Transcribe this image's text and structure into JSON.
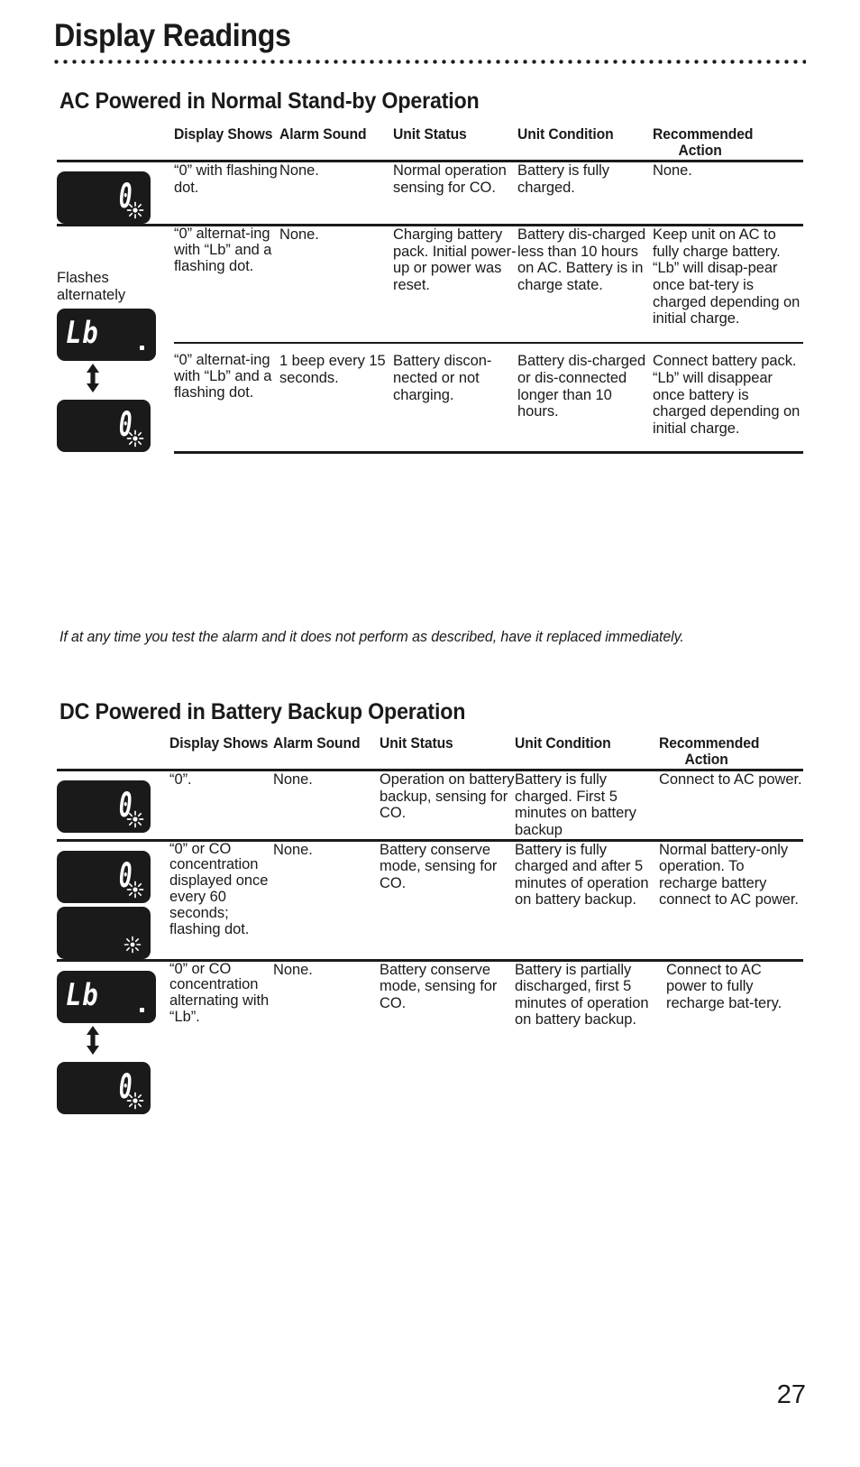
{
  "page": {
    "title": "Display Readings",
    "number": "27"
  },
  "note": {
    "text": "If at any time you test the alarm and it does not perform as described, have it replaced immediately."
  },
  "columns": {
    "display_shows": "Display Shows",
    "alarm_sound": "Alarm Sound",
    "unit_status": "Unit Status",
    "unit_condition": "Unit Condition",
    "recommended": "Recommended",
    "action": "Action"
  },
  "section_ac": {
    "heading": "AC Powered in Normal Stand-by Operation",
    "rows": [
      {
        "display_glyphs": [
          "0"
        ],
        "display_shows": "“0” with flashing dot.",
        "alarm_sound": "None.",
        "unit_status": "Normal operation sensing for CO.",
        "unit_condition": "Battery is fully charged.",
        "recommended_action": "None."
      },
      {
        "flashes_label": "Flashes alternately",
        "display_glyphs": [
          "Lb",
          "0"
        ],
        "display_shows": "“0” alternat-ing with “Lb” and a flashing dot.",
        "alarm_sound": "None.",
        "unit_status": "Charging battery pack. Initial power-up or power was reset.",
        "unit_condition": "Battery dis-charged less than 10 hours on AC. Battery is in charge state.",
        "recommended_action": "Keep unit on AC to fully charge battery. “Lb” will disap-pear once bat-tery is charged depending on initial charge."
      },
      {
        "display_shows": "“0” alternat-ing with “Lb” and a flashing dot.",
        "alarm_sound": "1 beep every 15 seconds.",
        "unit_status": "Battery discon-nected or not charging.",
        "unit_condition": "Battery dis-charged or dis-connected longer than 10 hours.",
        "recommended_action": "Connect battery pack. “Lb” will disappear once battery is charged depending on initial charge."
      }
    ]
  },
  "section_dc": {
    "heading": "DC Powered in Battery Backup Operation",
    "rows": [
      {
        "display_glyphs": [
          "0"
        ],
        "display_shows": "“0”.",
        "alarm_sound": "None.",
        "unit_status": "Operation on battery backup, sensing for CO.",
        "unit_condition": "Battery is fully charged. First 5 minutes on battery backup",
        "recommended_action": "Connect to AC power."
      },
      {
        "display_glyphs": [
          "0",
          "blank"
        ],
        "display_shows": "“0” or CO concentration displayed once every 60 seconds; flashing dot.",
        "alarm_sound": "None.",
        "unit_status": "Battery conserve mode, sensing for CO.",
        "unit_condition": "Battery is fully charged and after 5 minutes of operation on battery backup.",
        "recommended_action": "Normal battery-only operation. To recharge battery connect to AC power."
      },
      {
        "display_glyphs": [
          "Lb",
          "0"
        ],
        "display_shows": "“0” or CO concentration alternating with “Lb”.",
        "alarm_sound": "None.",
        "unit_status": "Battery conserve mode, sensing for CO.",
        "unit_condition": "Battery is partially discharged, first 5 minutes of operation on battery backup.",
        "recommended_action": "Connect to AC power to fully recharge bat-tery."
      }
    ]
  }
}
